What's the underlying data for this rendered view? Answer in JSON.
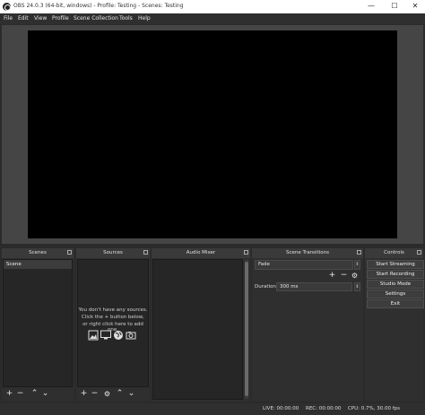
{
  "window": {
    "title": "OBS 24.0.3 (64-bit, windows) - Profile: Testing - Scenes: Testing",
    "min": "—",
    "max": "☐",
    "close": "✕"
  },
  "menu": [
    "File",
    "Edit",
    "View",
    "Profile",
    "Scene Collection",
    "Tools",
    "Help"
  ],
  "docks": {
    "scenes": {
      "title": "Scenes",
      "items": [
        "Scene"
      ]
    },
    "sources": {
      "title": "Sources",
      "empty_line1": "You don't have any sources.",
      "empty_line2": "Click the + button below,",
      "empty_line3": "or right click here to add one."
    },
    "mixer": {
      "title": "Audio Mixer"
    },
    "transitions": {
      "title": "Scene Transitions",
      "selected": "Fade",
      "duration_label": "Duration",
      "duration_value": "300 ms"
    },
    "controls": {
      "title": "Controls",
      "buttons": [
        "Start Streaming",
        "Start Recording",
        "Studio Mode",
        "Settings",
        "Exit"
      ]
    }
  },
  "toolbar_glyphs": {
    "add": "+",
    "remove": "−",
    "up": "⌃",
    "down": "⌄",
    "gear": "⚙"
  },
  "status": {
    "live": "LIVE: 00:00:00",
    "rec": "REC: 00:00:00",
    "cpu": "CPU: 0.7%, 30.00 fps"
  }
}
